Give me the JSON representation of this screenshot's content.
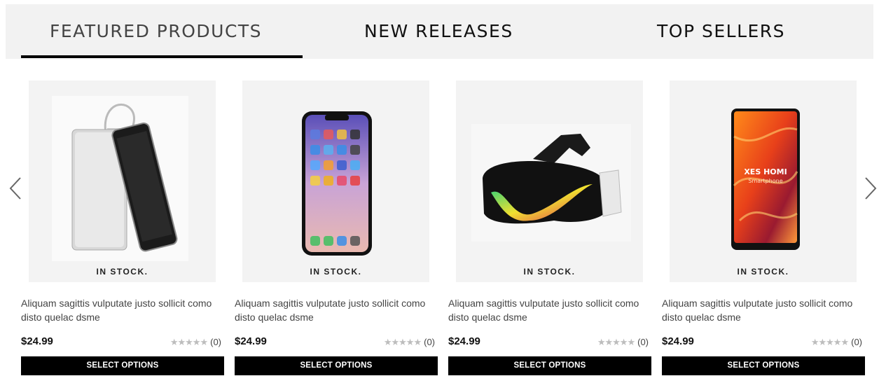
{
  "tabs": [
    {
      "label": "FEATURED PRODUCTS",
      "active": true
    },
    {
      "label": "NEW RELEASES",
      "active": false
    },
    {
      "label": "TOP SELLERS",
      "active": false
    }
  ],
  "carousel": {
    "prev_icon": "chevron-left-icon",
    "next_icon": "chevron-right-icon"
  },
  "products": [
    {
      "image": "power-bank-phone-image",
      "stock": "IN STOCK.",
      "title": "Aliquam sagittis vulputate justo sollicit como disto quelac dsme",
      "price": "$24.99",
      "rating": 0,
      "reviews": "(0)",
      "button": "SELECT OPTIONS"
    },
    {
      "image": "smartphone-image",
      "stock": "IN STOCK.",
      "title": "Aliquam sagittis vulputate justo sollicit como disto quelac dsme",
      "price": "$24.99",
      "rating": 0,
      "reviews": "(0)",
      "button": "SELECT OPTIONS"
    },
    {
      "image": "vr-headset-image",
      "stock": "IN STOCK.",
      "title": "Aliquam sagittis vulputate justo sollicit como disto quelac dsme",
      "price": "$24.99",
      "rating": 0,
      "reviews": "(0)",
      "button": "SELECT OPTIONS"
    },
    {
      "image": "xes-homi-smartphone-image",
      "image_text": "XES HOMI",
      "image_subtext": "Smartphone",
      "stock": "IN STOCK.",
      "title": "Aliquam sagittis vulputate justo sollicit como disto quelac dsme",
      "price": "$24.99",
      "rating": 0,
      "reviews": "(0)",
      "button": "SELECT OPTIONS"
    }
  ],
  "colors": {
    "tabbar_bg": "#f2f2f2",
    "image_bg": "#f3f3f3",
    "button_bg": "#000000",
    "star": "#bdbdbd"
  }
}
